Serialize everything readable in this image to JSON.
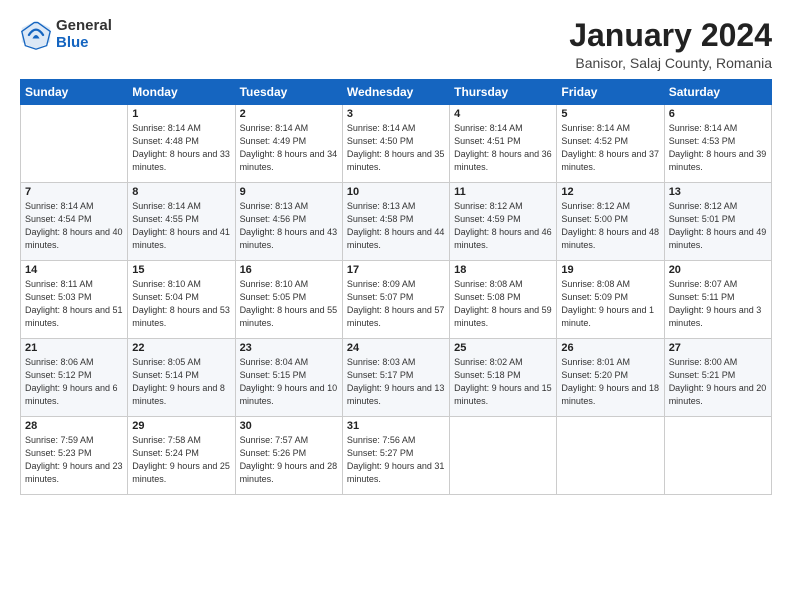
{
  "header": {
    "logo": {
      "general": "General",
      "blue": "Blue"
    },
    "title": "January 2024",
    "location": "Banisor, Salaj County, Romania"
  },
  "calendar": {
    "weekdays": [
      "Sunday",
      "Monday",
      "Tuesday",
      "Wednesday",
      "Thursday",
      "Friday",
      "Saturday"
    ],
    "rows": [
      [
        {
          "day": "",
          "sunrise": "",
          "sunset": "",
          "daylight": ""
        },
        {
          "day": "1",
          "sunrise": "Sunrise: 8:14 AM",
          "sunset": "Sunset: 4:48 PM",
          "daylight": "Daylight: 8 hours and 33 minutes."
        },
        {
          "day": "2",
          "sunrise": "Sunrise: 8:14 AM",
          "sunset": "Sunset: 4:49 PM",
          "daylight": "Daylight: 8 hours and 34 minutes."
        },
        {
          "day": "3",
          "sunrise": "Sunrise: 8:14 AM",
          "sunset": "Sunset: 4:50 PM",
          "daylight": "Daylight: 8 hours and 35 minutes."
        },
        {
          "day": "4",
          "sunrise": "Sunrise: 8:14 AM",
          "sunset": "Sunset: 4:51 PM",
          "daylight": "Daylight: 8 hours and 36 minutes."
        },
        {
          "day": "5",
          "sunrise": "Sunrise: 8:14 AM",
          "sunset": "Sunset: 4:52 PM",
          "daylight": "Daylight: 8 hours and 37 minutes."
        },
        {
          "day": "6",
          "sunrise": "Sunrise: 8:14 AM",
          "sunset": "Sunset: 4:53 PM",
          "daylight": "Daylight: 8 hours and 39 minutes."
        }
      ],
      [
        {
          "day": "7",
          "sunrise": "Sunrise: 8:14 AM",
          "sunset": "Sunset: 4:54 PM",
          "daylight": "Daylight: 8 hours and 40 minutes."
        },
        {
          "day": "8",
          "sunrise": "Sunrise: 8:14 AM",
          "sunset": "Sunset: 4:55 PM",
          "daylight": "Daylight: 8 hours and 41 minutes."
        },
        {
          "day": "9",
          "sunrise": "Sunrise: 8:13 AM",
          "sunset": "Sunset: 4:56 PM",
          "daylight": "Daylight: 8 hours and 43 minutes."
        },
        {
          "day": "10",
          "sunrise": "Sunrise: 8:13 AM",
          "sunset": "Sunset: 4:58 PM",
          "daylight": "Daylight: 8 hours and 44 minutes."
        },
        {
          "day": "11",
          "sunrise": "Sunrise: 8:12 AM",
          "sunset": "Sunset: 4:59 PM",
          "daylight": "Daylight: 8 hours and 46 minutes."
        },
        {
          "day": "12",
          "sunrise": "Sunrise: 8:12 AM",
          "sunset": "Sunset: 5:00 PM",
          "daylight": "Daylight: 8 hours and 48 minutes."
        },
        {
          "day": "13",
          "sunrise": "Sunrise: 8:12 AM",
          "sunset": "Sunset: 5:01 PM",
          "daylight": "Daylight: 8 hours and 49 minutes."
        }
      ],
      [
        {
          "day": "14",
          "sunrise": "Sunrise: 8:11 AM",
          "sunset": "Sunset: 5:03 PM",
          "daylight": "Daylight: 8 hours and 51 minutes."
        },
        {
          "day": "15",
          "sunrise": "Sunrise: 8:10 AM",
          "sunset": "Sunset: 5:04 PM",
          "daylight": "Daylight: 8 hours and 53 minutes."
        },
        {
          "day": "16",
          "sunrise": "Sunrise: 8:10 AM",
          "sunset": "Sunset: 5:05 PM",
          "daylight": "Daylight: 8 hours and 55 minutes."
        },
        {
          "day": "17",
          "sunrise": "Sunrise: 8:09 AM",
          "sunset": "Sunset: 5:07 PM",
          "daylight": "Daylight: 8 hours and 57 minutes."
        },
        {
          "day": "18",
          "sunrise": "Sunrise: 8:08 AM",
          "sunset": "Sunset: 5:08 PM",
          "daylight": "Daylight: 8 hours and 59 minutes."
        },
        {
          "day": "19",
          "sunrise": "Sunrise: 8:08 AM",
          "sunset": "Sunset: 5:09 PM",
          "daylight": "Daylight: 9 hours and 1 minute."
        },
        {
          "day": "20",
          "sunrise": "Sunrise: 8:07 AM",
          "sunset": "Sunset: 5:11 PM",
          "daylight": "Daylight: 9 hours and 3 minutes."
        }
      ],
      [
        {
          "day": "21",
          "sunrise": "Sunrise: 8:06 AM",
          "sunset": "Sunset: 5:12 PM",
          "daylight": "Daylight: 9 hours and 6 minutes."
        },
        {
          "day": "22",
          "sunrise": "Sunrise: 8:05 AM",
          "sunset": "Sunset: 5:14 PM",
          "daylight": "Daylight: 9 hours and 8 minutes."
        },
        {
          "day": "23",
          "sunrise": "Sunrise: 8:04 AM",
          "sunset": "Sunset: 5:15 PM",
          "daylight": "Daylight: 9 hours and 10 minutes."
        },
        {
          "day": "24",
          "sunrise": "Sunrise: 8:03 AM",
          "sunset": "Sunset: 5:17 PM",
          "daylight": "Daylight: 9 hours and 13 minutes."
        },
        {
          "day": "25",
          "sunrise": "Sunrise: 8:02 AM",
          "sunset": "Sunset: 5:18 PM",
          "daylight": "Daylight: 9 hours and 15 minutes."
        },
        {
          "day": "26",
          "sunrise": "Sunrise: 8:01 AM",
          "sunset": "Sunset: 5:20 PM",
          "daylight": "Daylight: 9 hours and 18 minutes."
        },
        {
          "day": "27",
          "sunrise": "Sunrise: 8:00 AM",
          "sunset": "Sunset: 5:21 PM",
          "daylight": "Daylight: 9 hours and 20 minutes."
        }
      ],
      [
        {
          "day": "28",
          "sunrise": "Sunrise: 7:59 AM",
          "sunset": "Sunset: 5:23 PM",
          "daylight": "Daylight: 9 hours and 23 minutes."
        },
        {
          "day": "29",
          "sunrise": "Sunrise: 7:58 AM",
          "sunset": "Sunset: 5:24 PM",
          "daylight": "Daylight: 9 hours and 25 minutes."
        },
        {
          "day": "30",
          "sunrise": "Sunrise: 7:57 AM",
          "sunset": "Sunset: 5:26 PM",
          "daylight": "Daylight: 9 hours and 28 minutes."
        },
        {
          "day": "31",
          "sunrise": "Sunrise: 7:56 AM",
          "sunset": "Sunset: 5:27 PM",
          "daylight": "Daylight: 9 hours and 31 minutes."
        },
        {
          "day": "",
          "sunrise": "",
          "sunset": "",
          "daylight": ""
        },
        {
          "day": "",
          "sunrise": "",
          "sunset": "",
          "daylight": ""
        },
        {
          "day": "",
          "sunrise": "",
          "sunset": "",
          "daylight": ""
        }
      ]
    ]
  }
}
